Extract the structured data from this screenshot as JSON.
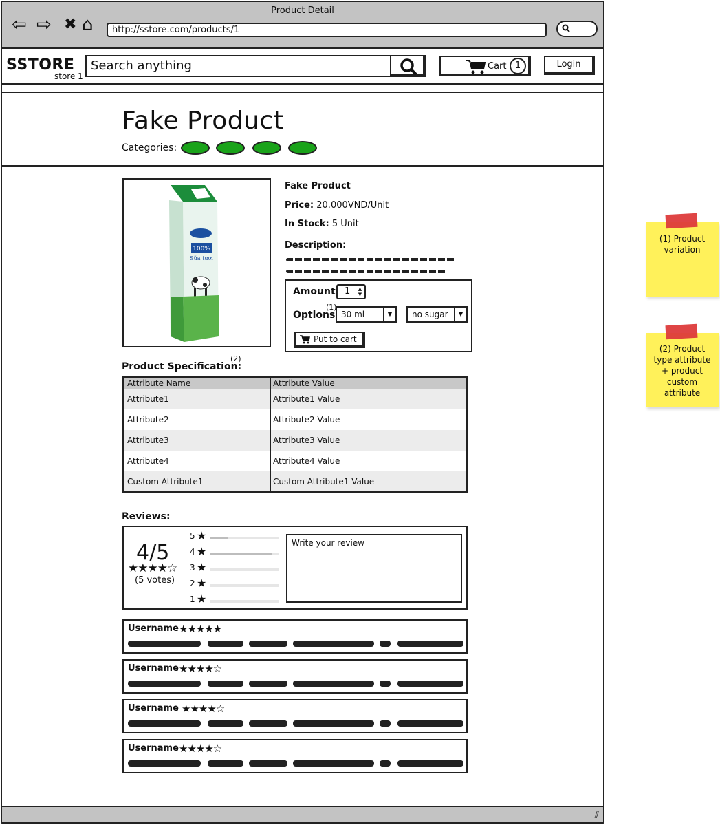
{
  "window": {
    "title": "Product Detail",
    "url": "http://sstore.com/products/1"
  },
  "header": {
    "logo": "SSTORE",
    "logo_sub": "store 1",
    "search_placeholder": "Search anything",
    "cart_label": "Cart",
    "cart_count": "1",
    "login_label": "Login"
  },
  "product": {
    "title": "Fake Product",
    "categories_label": "Categories:",
    "categories_count": 4,
    "name": "Fake Product",
    "price_label": "Price:",
    "price_value": "20.000VND/Unit",
    "stock_label": "In Stock:",
    "stock_value": "5 Unit",
    "description_label": "Description:",
    "image_icon": "milk-carton-image"
  },
  "purchase": {
    "amount_label": "Amount:",
    "amount_value": "1",
    "options_label": "Options:",
    "options_note": "(1)",
    "option1_selected": "30 ml",
    "option2_selected": "no sugar",
    "put_to_cart_label": "Put to cart"
  },
  "specification": {
    "title": "Product Specification:",
    "note": "(2)",
    "columns": [
      "Attribute Name",
      "Attribute Value"
    ],
    "rows": [
      [
        "Attribute1",
        "Attribute1 Value"
      ],
      [
        "Attribute2",
        "Attribute2  Value"
      ],
      [
        "Attribute3",
        "Attribute3 Value"
      ],
      [
        "Attribute4",
        "Attribute4  Value"
      ],
      [
        "Custom Attribute1",
        "Custom Attribute1 Value"
      ]
    ]
  },
  "reviews": {
    "title": "Reviews:",
    "score": "4/5",
    "stars": "★★★★☆",
    "votes": "(5 votes)",
    "distribution": [
      {
        "label": "5",
        "fraction": 0.25
      },
      {
        "label": "4",
        "fraction": 0.9
      },
      {
        "label": "3",
        "fraction": 0
      },
      {
        "label": "2",
        "fraction": 0
      },
      {
        "label": "1",
        "fraction": 0
      }
    ],
    "write_placeholder": "Write your review",
    "items": [
      {
        "user": "Username",
        "stars": "★★★★★"
      },
      {
        "user": "Username",
        "stars": "★★★★☆"
      },
      {
        "user": "Username",
        "stars": "★★★★☆"
      },
      {
        "user": "Username",
        "stars": "★★★★☆"
      }
    ]
  },
  "notes": [
    {
      "text": "(1) Product variation"
    },
    {
      "text": "(2) Product type attribute + product custom attribute"
    }
  ],
  "colors": {
    "category_pill": "#1aa31a",
    "sticky": "#fff15a",
    "tape": "#dd3b3b",
    "chrome": "#c3c3c3"
  }
}
